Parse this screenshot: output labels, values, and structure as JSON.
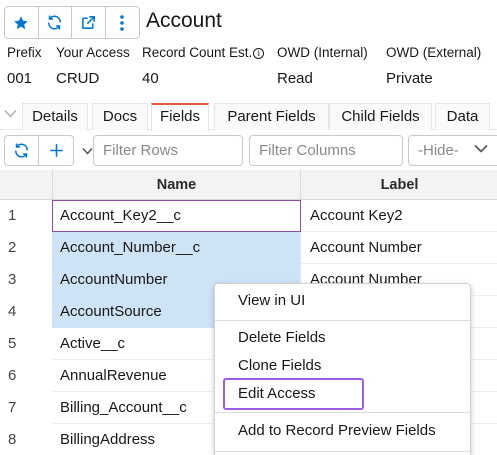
{
  "header": {
    "title": "Account",
    "actions": [
      {
        "icon": "star-icon"
      },
      {
        "icon": "refresh-icon"
      },
      {
        "icon": "external-link-icon"
      },
      {
        "icon": "more-vertical-icon"
      }
    ]
  },
  "meta": [
    {
      "label": "Prefix",
      "value": "001"
    },
    {
      "label": "Your Access",
      "value": "CRUD"
    },
    {
      "label": "Record Count Est.",
      "value": "40"
    },
    {
      "label": "OWD (Internal)",
      "value": "Read"
    },
    {
      "label": "OWD (External)",
      "value": "Private"
    }
  ],
  "tabs": [
    "Details",
    "Docs",
    "Fields",
    "Parent Fields",
    "Child Fields",
    "Data"
  ],
  "active_tab": "Fields",
  "toolbar": {
    "filter_rows_placeholder": "Filter Rows",
    "filter_columns_placeholder": "Filter Columns",
    "hide_select": "-Hide-"
  },
  "grid": {
    "columns": [
      "Name",
      "Label"
    ],
    "rows": [
      {
        "num": "1",
        "name": "Account_Key2__c",
        "label": "Account Key2"
      },
      {
        "num": "2",
        "name": "Account_Number__c",
        "label": "Account Number"
      },
      {
        "num": "3",
        "name": "AccountNumber",
        "label": "Account Number"
      },
      {
        "num": "4",
        "name": "AccountSource",
        "label": ""
      },
      {
        "num": "5",
        "name": "Active__c",
        "label": ""
      },
      {
        "num": "6",
        "name": "AnnualRevenue",
        "label": ""
      },
      {
        "num": "7",
        "name": "Billing_Account__c",
        "label": ""
      },
      {
        "num": "8",
        "name": "BillingAddress",
        "label": ""
      }
    ]
  },
  "context_menu": {
    "items": [
      "View in UI",
      "Delete Fields",
      "Clone Fields",
      "Edit Access",
      "Add to Record Preview Fields"
    ],
    "highlighted": "Edit Access"
  },
  "colors": {
    "accent_blue": "#0176d3",
    "selection": "#cfe3f7",
    "active_tab_top": "#e35b3d",
    "highlight_outline": "#9b5de5"
  }
}
